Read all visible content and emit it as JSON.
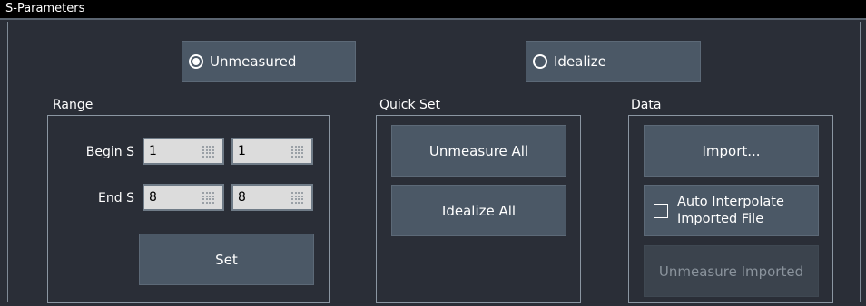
{
  "window": {
    "title": "S-Parameters"
  },
  "mode": {
    "unmeasured_label": "Unmeasured",
    "unmeasured_selected": true,
    "idealize_label": "Idealize",
    "idealize_selected": false
  },
  "range": {
    "group_label": "Range",
    "begin_label": "Begin S",
    "end_label": "End S",
    "begin_1": "1",
    "begin_2": "1",
    "end_1": "8",
    "end_2": "8",
    "set_label": "Set"
  },
  "quickset": {
    "group_label": "Quick Set",
    "unmeasure_all_label": "Unmeasure All",
    "idealize_all_label": "Idealize All"
  },
  "data": {
    "group_label": "Data",
    "import_label": "Import...",
    "auto_interpolate_label": "Auto Interpolate Imported File",
    "auto_interpolate_checked": false,
    "unmeasure_imported_label": "Unmeasure Imported"
  },
  "colors": {
    "background": "#2a2e37",
    "button": "#4b5866",
    "field": "#dcdcdc"
  }
}
